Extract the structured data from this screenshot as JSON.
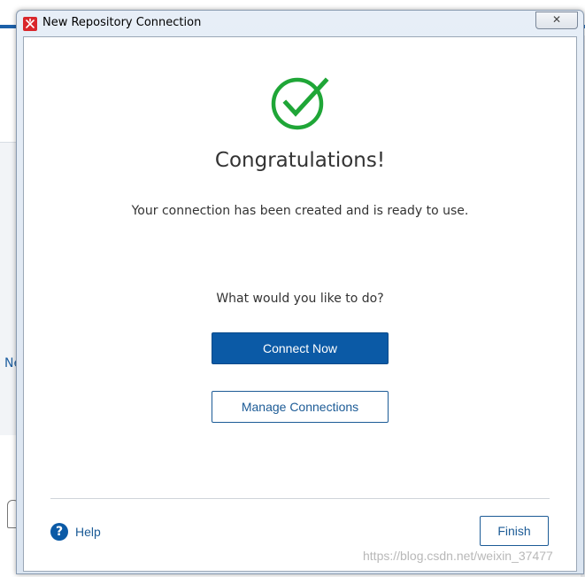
{
  "window": {
    "title": "New Repository Connection",
    "close_glyph": "✕"
  },
  "background": {
    "partial_label": "Ne"
  },
  "main": {
    "heading": "Congratulations!",
    "message": "Your connection has been created and is ready to use.",
    "question": "What would you like to do?",
    "connect_now_label": "Connect Now",
    "manage_connections_label": "Manage Connections"
  },
  "footer": {
    "help_label": "Help",
    "help_glyph": "?",
    "finish_label": "Finish"
  },
  "watermark": "https://blog.csdn.net/weixin_37477",
  "colors": {
    "success_green": "#1fa637",
    "primary_blue": "#0b5aa6",
    "app_icon_red": "#d9262b"
  },
  "icons": {
    "app": "app-logo-icon",
    "success": "checkmark-circle-icon",
    "help": "help-circle-icon",
    "close": "close-icon"
  }
}
